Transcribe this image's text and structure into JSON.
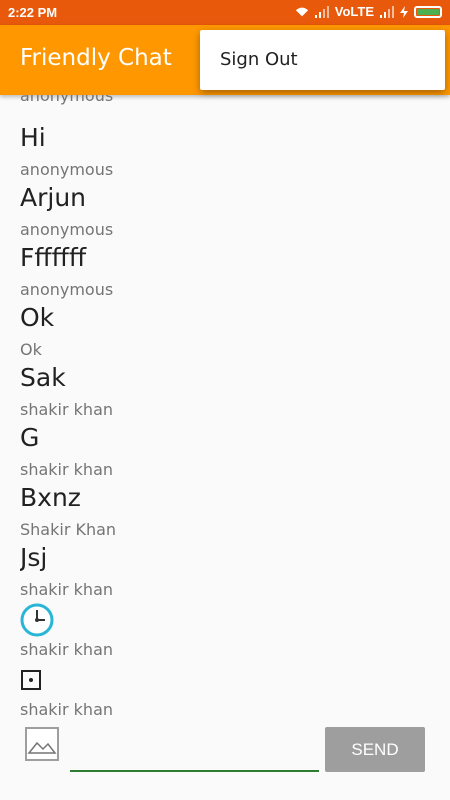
{
  "status_bar": {
    "time": "2:22 PM",
    "network": "VoLTE",
    "icons": [
      "wifi-icon",
      "signal-icon",
      "charging-icon",
      "battery-icon"
    ]
  },
  "app_bar": {
    "title": "Friendly Chat"
  },
  "overflow_menu": {
    "items": [
      {
        "label": "Sign Out"
      }
    ]
  },
  "messages": [
    {
      "text": "Hi",
      "sender": "anonymous"
    },
    {
      "text": "Arjun",
      "sender": "anonymous"
    },
    {
      "text": "Fffffff",
      "sender": "anonymous"
    },
    {
      "text": "Ok",
      "sender": "Ok"
    },
    {
      "text": "Sak",
      "sender": "shakir khan"
    },
    {
      "text": "G",
      "sender": "shakir khan"
    },
    {
      "text": "Bxnz",
      "sender": "Shakir Khan"
    },
    {
      "text": "Jsj",
      "sender": "shakir khan"
    },
    {
      "image": "clock-emoji-icon",
      "sender": "shakir khan"
    },
    {
      "image": "dotted-square-icon",
      "sender": "shakir khan"
    }
  ],
  "composer": {
    "image_picker_icon": "image-icon",
    "input_value": "",
    "send_label": "SEND"
  },
  "colors": {
    "status_bar": "#e8590c",
    "app_bar": "#ff9800",
    "send_button": "#9e9e9e",
    "input_underline": "#2e7d32"
  }
}
